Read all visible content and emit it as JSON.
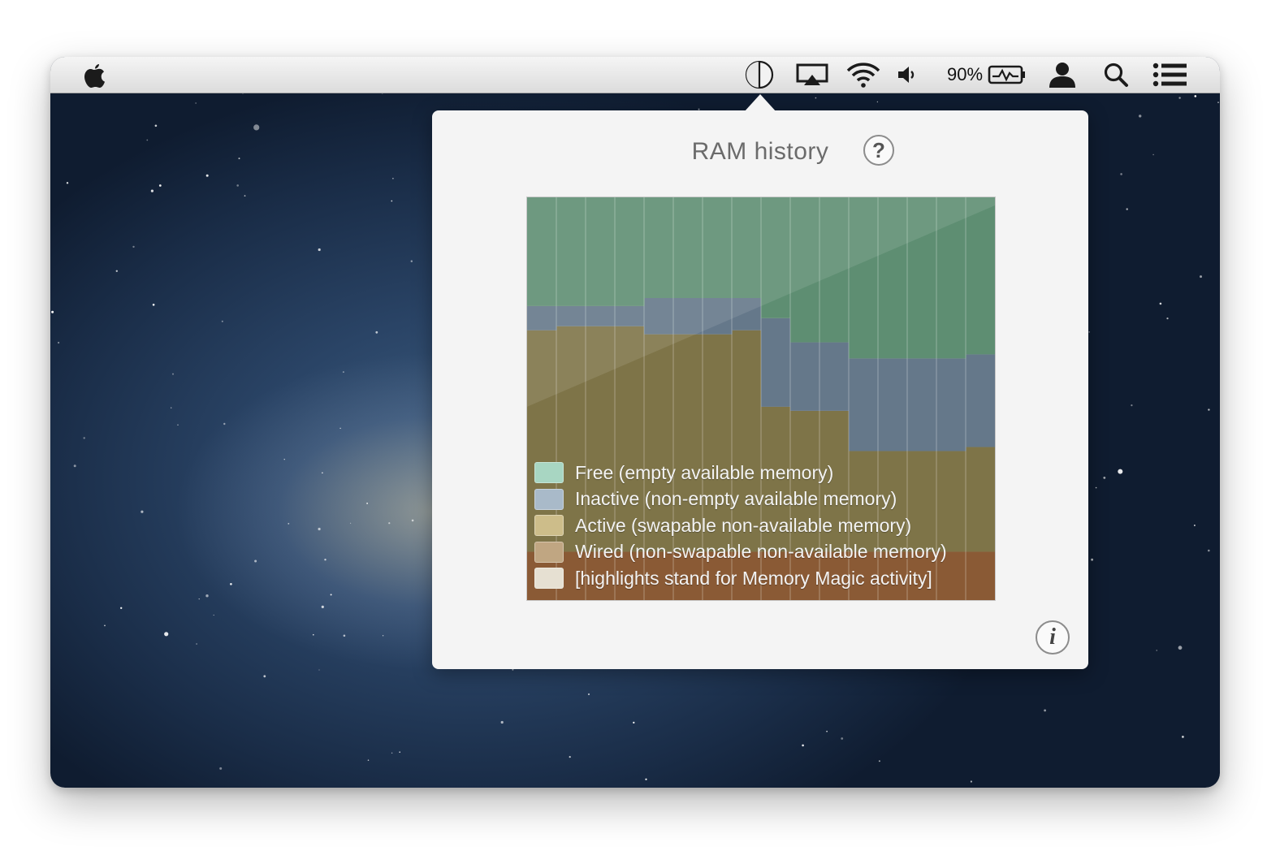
{
  "menubar": {
    "icons": [
      "apple-logo",
      "memory-magic-icon",
      "airplay-icon",
      "wifi-icon",
      "volume-icon",
      "battery-icon",
      "user-icon",
      "search-icon",
      "notification-list-icon"
    ],
    "battery_percent": "90%"
  },
  "popover": {
    "title": "RAM history",
    "help_label": "?",
    "info_label": "i"
  },
  "chart_data": {
    "type": "area",
    "stacked": true,
    "y_unit": "percent",
    "x": [
      1,
      2,
      3,
      4,
      5,
      6,
      7,
      8,
      9,
      10,
      11,
      12,
      13,
      14,
      15,
      16
    ],
    "series": [
      {
        "name": "Wired (non-swapable non-available memory)",
        "color": "#8a5a35",
        "values": [
          12,
          12,
          12,
          12,
          12,
          12,
          12,
          12,
          12,
          12,
          12,
          12,
          12,
          12,
          12,
          12
        ]
      },
      {
        "name": "Active (swapable non-available memory)",
        "color": "#7e7448",
        "values": [
          55,
          56,
          56,
          56,
          54,
          54,
          54,
          55,
          36,
          35,
          35,
          25,
          25,
          25,
          25,
          26
        ]
      },
      {
        "name": "Inactive (non-empty available memory)",
        "color": "#65788a",
        "values": [
          6,
          5,
          5,
          5,
          9,
          9,
          9,
          8,
          22,
          17,
          17,
          23,
          23,
          23,
          23,
          23
        ]
      },
      {
        "name": "Free (empty available memory)",
        "color": "#5e8e72",
        "values": [
          27,
          27,
          27,
          27,
          25,
          25,
          25,
          25,
          30,
          36,
          36,
          40,
          40,
          40,
          40,
          39
        ]
      }
    ],
    "legend": [
      {
        "label": "Free (empty available memory)",
        "color": "#a8d6c2"
      },
      {
        "label": "Inactive (non-empty available memory)",
        "color": "#a9bac9"
      },
      {
        "label": "Active (swapable non-available memory)",
        "color": "#cdbd8a"
      },
      {
        "label": "Wired (non-swapable non-available memory)",
        "color": "#c0a682"
      },
      {
        "label": "[highlights stand for Memory Magic activity]",
        "color": "#e6e0d2"
      }
    ],
    "legend_position": "bottom-left",
    "grid": true
  }
}
